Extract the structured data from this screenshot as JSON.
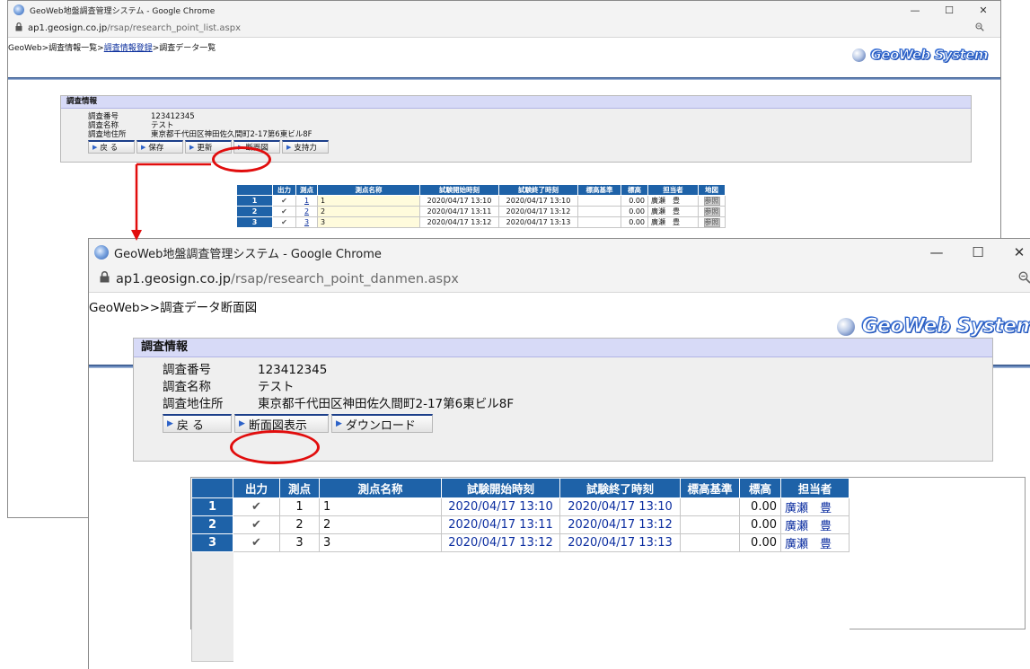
{
  "colors": {
    "accent_red": "#e10d0d",
    "grid_header": "#1e62a8",
    "panel_head": "#d7daf7",
    "name_cell": "#fffbdc"
  },
  "back_window": {
    "title": "GeoWeb地盤調査管理システム - Google Chrome",
    "controls": {
      "minimize": "—",
      "maximize": "☐",
      "close": "✕"
    },
    "url": {
      "host": "ap1.geosign.co.jp",
      "path": "/rsap/research_point_list.aspx",
      "lock_icon": "lock-icon",
      "zoom_icon": "zoom-icon"
    },
    "breadcrumb": {
      "part1": "GeoWeb>調査情報一覧>",
      "link": "調査情報登録",
      "part2": ">調査データ一覧"
    },
    "brand": "GeoWeb System",
    "panel": {
      "heading": "調査情報",
      "rows": [
        {
          "key": "調査番号",
          "value": "123412345"
        },
        {
          "key": "調査名称",
          "value": "テスト"
        },
        {
          "key": "調査地住所",
          "value": "東京都千代田区神田佐久間町2-17第6東ビル8F"
        }
      ],
      "buttons": {
        "back": "戻 る",
        "save": "保存",
        "update": "更新",
        "section": "断面図",
        "support": "支持力"
      }
    },
    "table": {
      "headers": [
        "出力",
        "測点",
        "測点名称",
        "試験開始時刻",
        "試験終了時刻",
        "標高基準",
        "標高",
        "担当者",
        "地図"
      ],
      "rows": [
        {
          "no": "1",
          "check": "✔",
          "point": "1",
          "name": "1",
          "start": "2020/04/17 13:10",
          "end": "2020/04/17 13:10",
          "base": "",
          "elev": "0.00",
          "person": "廣瀬　豊",
          "map": "参照"
        },
        {
          "no": "2",
          "check": "✔",
          "point": "2",
          "name": "2",
          "start": "2020/04/17 13:11",
          "end": "2020/04/17 13:12",
          "base": "",
          "elev": "0.00",
          "person": "廣瀬　豊",
          "map": "参照"
        },
        {
          "no": "3",
          "check": "✔",
          "point": "3",
          "name": "3",
          "start": "2020/04/17 13:12",
          "end": "2020/04/17 13:13",
          "base": "",
          "elev": "0.00",
          "person": "廣瀬　豊",
          "map": "参照"
        }
      ]
    }
  },
  "front_window": {
    "title": "GeoWeb地盤調査管理システム - Google Chrome",
    "controls": {
      "minimize": "—",
      "maximize": "☐",
      "close": "✕"
    },
    "url": {
      "host": "ap1.geosign.co.jp",
      "path": "/rsap/research_point_danmen.aspx",
      "lock_icon": "lock-icon",
      "zoom_icon": "zoom-icon"
    },
    "breadcrumb": "GeoWeb>>調査データ断面図",
    "brand": "GeoWeb System",
    "panel": {
      "heading": "調査情報",
      "rows": [
        {
          "key": "調査番号",
          "value": "123412345"
        },
        {
          "key": "調査名称",
          "value": "テスト"
        },
        {
          "key": "調査地住所",
          "value": "東京都千代田区神田佐久間町2-17第6東ビル8F"
        }
      ],
      "buttons": {
        "back": "戻 る",
        "show_section": "断面図表示",
        "download": "ダウンロード"
      }
    },
    "table": {
      "headers": [
        "出力",
        "測点",
        "測点名称",
        "試験開始時刻",
        "試験終了時刻",
        "標高基準",
        "標高",
        "担当者"
      ],
      "rows": [
        {
          "no": "1",
          "check": "✔",
          "point": "1",
          "name": "1",
          "start": "2020/04/17 13:10",
          "end": "2020/04/17 13:10",
          "base": "",
          "elev": "0.00",
          "person": "廣瀬　豊"
        },
        {
          "no": "2",
          "check": "✔",
          "point": "2",
          "name": "2",
          "start": "2020/04/17 13:11",
          "end": "2020/04/17 13:12",
          "base": "",
          "elev": "0.00",
          "person": "廣瀬　豊"
        },
        {
          "no": "3",
          "check": "✔",
          "point": "3",
          "name": "3",
          "start": "2020/04/17 13:12",
          "end": "2020/04/17 13:13",
          "base": "",
          "elev": "0.00",
          "person": "廣瀬　豊"
        }
      ]
    }
  }
}
